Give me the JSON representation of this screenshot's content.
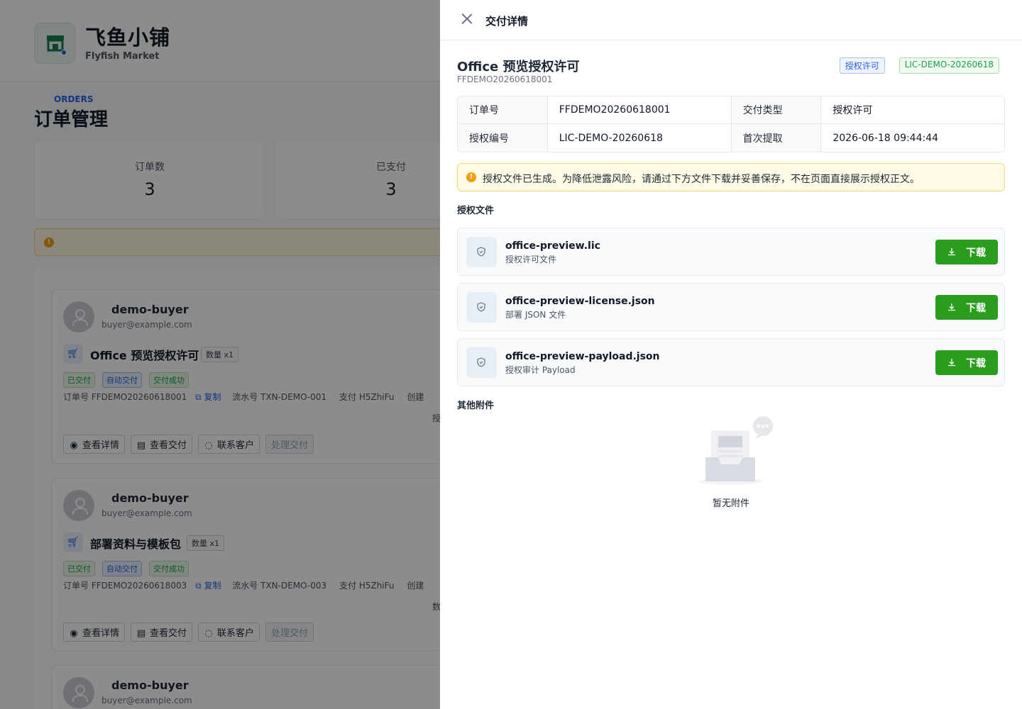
{
  "brand": {
    "name": "飞鱼小铺",
    "subtitle": "Flyfish Market"
  },
  "orders_page": {
    "eyebrow": "ORDERS",
    "title": "订单管理",
    "stats": [
      {
        "label": "订单数",
        "value": "3"
      },
      {
        "label": "已支付",
        "value": "3"
      }
    ],
    "alert_icon": "warning-icon"
  },
  "orders": [
    {
      "buyer": "demo-buyer",
      "email": "buyer@example.com",
      "product": "Office 预览授权许可",
      "qty": "数量 x1",
      "tags": [
        "已交付",
        "自动交付",
        "交付成功"
      ],
      "order_no": "订单号 FFDEMO20260618001",
      "copy": "复制",
      "txn": "流水号 TXN-DEMO-001",
      "pay": "支付 H5ZhiFu",
      "created": "创建",
      "extra": "授",
      "actions": [
        "查看详情",
        "查看交付",
        "联系客户",
        "处理交付"
      ]
    },
    {
      "buyer": "demo-buyer",
      "email": "buyer@example.com",
      "product": "部署资料与模板包",
      "qty": "数量 x1",
      "tags": [
        "已交付",
        "自动交付",
        "交付成功"
      ],
      "order_no": "订单号 FFDEMO20260618003",
      "copy": "复制",
      "txn": "流水号 TXN-DEMO-003",
      "pay": "支付 H5ZhiFu",
      "created": "创建",
      "extra": "数",
      "actions": [
        "查看详情",
        "查看交付",
        "联系客户",
        "处理交付"
      ]
    },
    {
      "buyer": "demo-buyer",
      "email": "buyer@example.com"
    }
  ],
  "drawer": {
    "title": "交付详情",
    "product_title": "Office 预览授权许可",
    "product_sub": "FFDEMO20260618001",
    "tags": [
      "授权许可",
      "LIC-DEMO-20260618"
    ],
    "desc": {
      "order_no_label": "订单号",
      "order_no": "FFDEMO20260618001",
      "type_label": "交付类型",
      "type": "授权许可",
      "license_label": "授权编号",
      "license": "LIC-DEMO-20260618",
      "first_label": "首次提取",
      "first": "2026-06-18 09:44:44"
    },
    "notice": "授权文件已生成。为降低泄露风险，请通过下方文件下载并妥善保存，不在页面直接展示授权正文。",
    "files_title": "授权文件",
    "files": [
      {
        "name": "office-preview.lic",
        "type": "授权许可文件",
        "button": "下载"
      },
      {
        "name": "office-preview-license.json",
        "type": "部署 JSON 文件",
        "button": "下载"
      },
      {
        "name": "office-preview-payload.json",
        "type": "授权审计 Payload",
        "button": "下载"
      }
    ],
    "attachments_title": "其他附件",
    "empty_text": "暂无附件"
  },
  "colors": {
    "primary": "#2563eb",
    "download_button": "#2a9c1e",
    "overlay": "rgba(0,0,0,0.45)"
  }
}
